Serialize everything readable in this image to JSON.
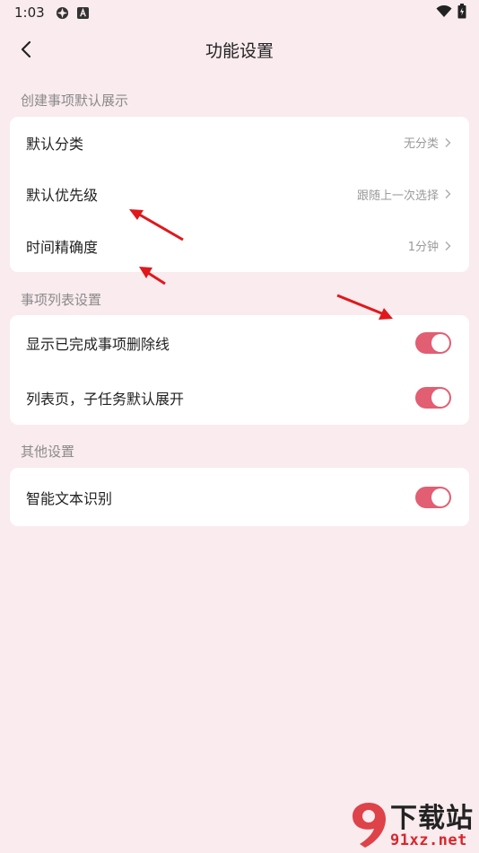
{
  "status_bar": {
    "time": "1:03"
  },
  "header": {
    "title": "功能设置"
  },
  "sections": [
    {
      "title": "创建事项默认展示",
      "rows": [
        {
          "label": "默认分类",
          "value": "无分类"
        },
        {
          "label": "默认优先级",
          "value": "跟随上一次选择"
        },
        {
          "label": "时间精确度",
          "value": "1分钟"
        }
      ]
    },
    {
      "title": "事项列表设置",
      "rows": [
        {
          "label": "显示已完成事项删除线",
          "toggle": true
        },
        {
          "label": "列表页，子任务默认展开",
          "toggle": true
        }
      ]
    },
    {
      "title": "其他设置",
      "rows": [
        {
          "label": "智能文本识别",
          "toggle": true
        }
      ]
    }
  ],
  "watermark": {
    "top_text": "下载站",
    "bottom_text": "91xz.net"
  },
  "colors": {
    "background": "#f9ebee",
    "accent": "#e25e72",
    "arrow": "#e0181c"
  }
}
